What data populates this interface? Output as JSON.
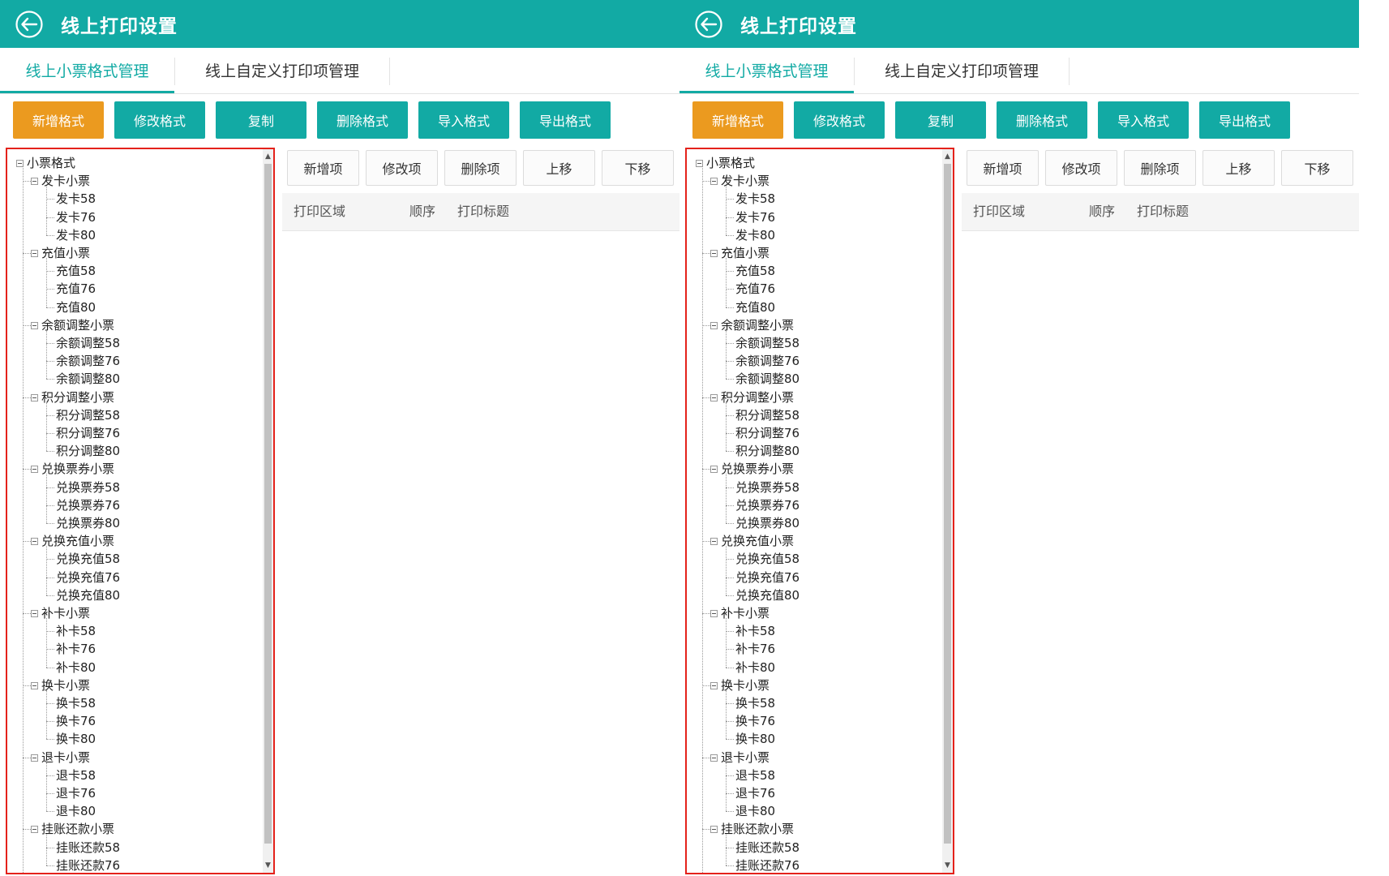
{
  "header": {
    "title": "线上打印设置"
  },
  "tabs": [
    {
      "label": "线上小票格式管理"
    },
    {
      "label": "线上自定义打印项管理"
    }
  ],
  "toolbar": [
    {
      "label": "新增格式"
    },
    {
      "label": "修改格式"
    },
    {
      "label": "复制"
    },
    {
      "label": "删除格式"
    },
    {
      "label": "导入格式"
    },
    {
      "label": "导出格式"
    }
  ],
  "tree": {
    "root": "小票格式",
    "groups": [
      {
        "label": "发卡小票",
        "items": [
          "发卡58",
          "发卡76",
          "发卡80"
        ]
      },
      {
        "label": "充值小票",
        "items": [
          "充值58",
          "充值76",
          "充值80"
        ]
      },
      {
        "label": "余额调整小票",
        "items": [
          "余额调整58",
          "余额调整76",
          "余额调整80"
        ]
      },
      {
        "label": "积分调整小票",
        "items": [
          "积分调整58",
          "积分调整76",
          "积分调整80"
        ]
      },
      {
        "label": "兑换票券小票",
        "items": [
          "兑换票券58",
          "兑换票券76",
          "兑换票券80"
        ]
      },
      {
        "label": "兑换充值小票",
        "items": [
          "兑换充值58",
          "兑换充值76",
          "兑换充值80"
        ]
      },
      {
        "label": "补卡小票",
        "items": [
          "补卡58",
          "补卡76",
          "补卡80"
        ]
      },
      {
        "label": "换卡小票",
        "items": [
          "换卡58",
          "换卡76",
          "换卡80"
        ]
      },
      {
        "label": "退卡小票",
        "items": [
          "退卡58",
          "退卡76",
          "退卡80"
        ]
      },
      {
        "label": "挂账还款小票",
        "items": [
          "挂账还款58",
          "挂账还款76"
        ]
      }
    ]
  },
  "item_toolbar": [
    {
      "label": "新增项"
    },
    {
      "label": "修改项"
    },
    {
      "label": "删除项"
    },
    {
      "label": "上移"
    },
    {
      "label": "下移"
    }
  ],
  "table": {
    "columns": [
      "打印区域",
      "顺序",
      "打印标题"
    ]
  },
  "scrollbar": {
    "up_glyph": "▲",
    "down_glyph": "▼"
  },
  "colors": {
    "header": "#12aaa4",
    "primary_button": "#eb9a1f",
    "highlight_border": "#e4221b"
  }
}
